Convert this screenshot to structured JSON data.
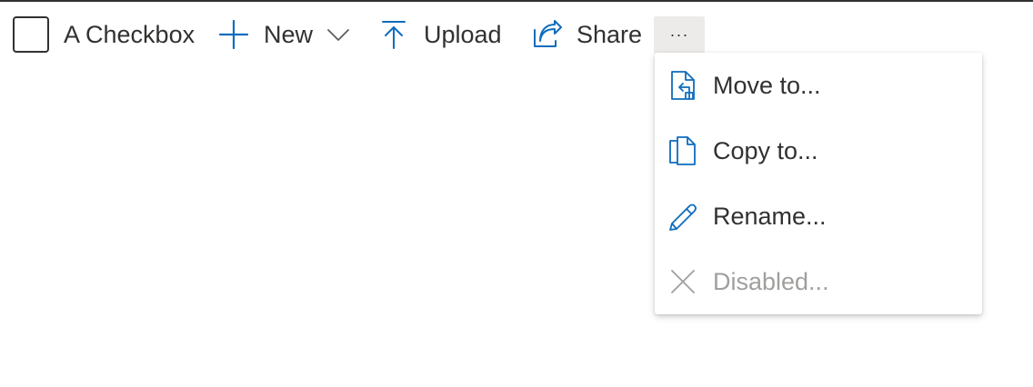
{
  "colors": {
    "accent": "#0f6cbd",
    "text": "#323130",
    "disabled_text": "#a19f9d",
    "more_button_bg": "#edebe9"
  },
  "toolbar": {
    "checkbox_label": "A Checkbox",
    "new_label": "New",
    "upload_label": "Upload",
    "share_label": "Share",
    "more_label": "···"
  },
  "icons": {
    "new": "plus-icon",
    "new_dropdown": "chevron-down-icon",
    "upload": "upload-icon",
    "share": "share-icon",
    "move": "move-icon",
    "copy": "copy-icon",
    "rename": "pencil-icon",
    "disabled": "close-icon"
  },
  "menu": {
    "items": [
      {
        "label": "Move to...",
        "disabled": false
      },
      {
        "label": "Copy to...",
        "disabled": false
      },
      {
        "label": "Rename...",
        "disabled": false
      },
      {
        "label": "Disabled...",
        "disabled": true
      }
    ]
  }
}
